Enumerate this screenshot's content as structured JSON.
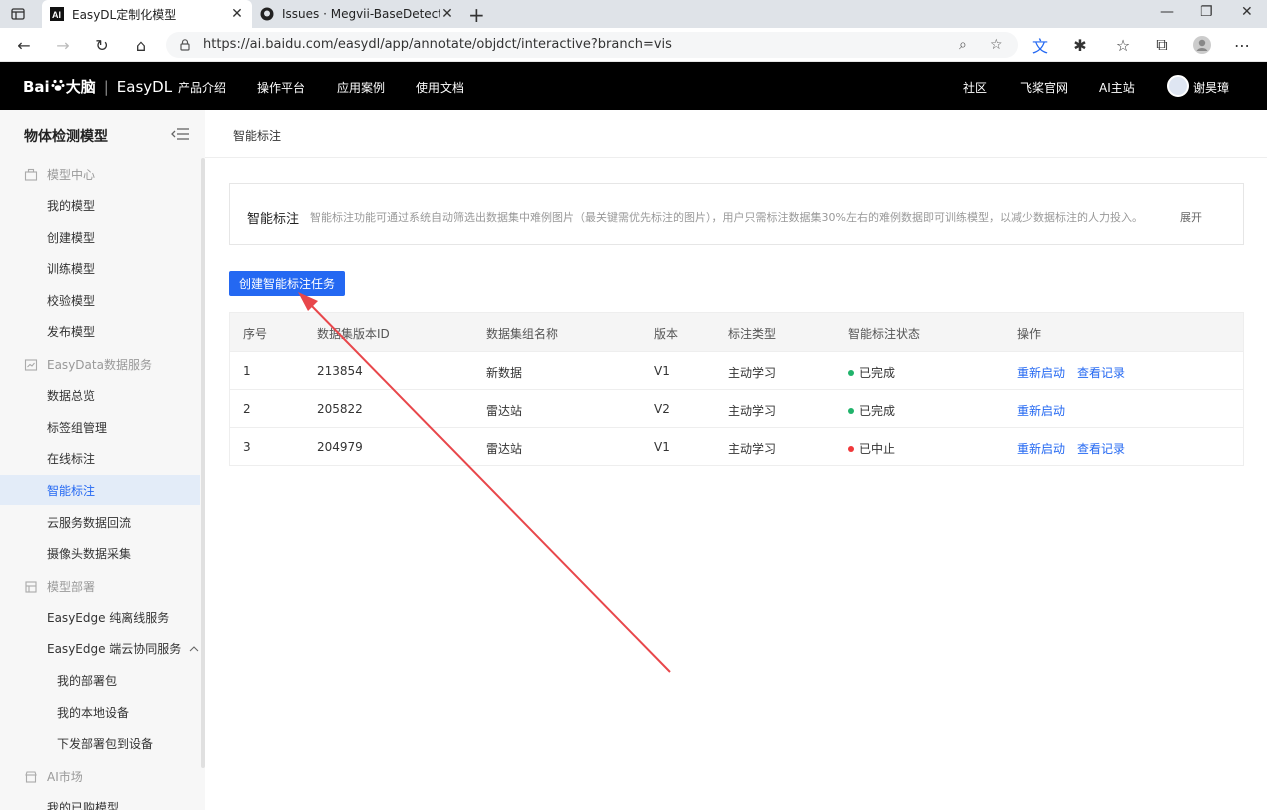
{
  "browser": {
    "tabs": [
      {
        "title": "EasyDL定制化模型",
        "active": true
      },
      {
        "title": "Issues · Megvii-BaseDetection/Y(",
        "active": false
      }
    ],
    "url": "https://ai.baidu.com/easydl/app/annotate/objdct/interactive?branch=vis"
  },
  "header": {
    "brand": "Bai",
    "brand_suffix": "大脑",
    "product": "EasyDL",
    "nav": [
      "产品介绍",
      "操作平台",
      "应用案例",
      "使用文档"
    ],
    "right_nav": [
      "社区",
      "飞桨官网",
      "AI主站"
    ],
    "user_name": "谢昊璋"
  },
  "sidebar": {
    "title": "物体检测模型",
    "groups": [
      {
        "label": "模型中心",
        "items": [
          "我的模型",
          "创建模型",
          "训练模型",
          "校验模型",
          "发布模型"
        ]
      },
      {
        "label": "EasyData数据服务",
        "items": [
          "数据总览",
          "标签组管理",
          "在线标注",
          "智能标注",
          "云服务数据回流",
          "摄像头数据采集"
        ]
      },
      {
        "label": "模型部署",
        "items": [
          "EasyEdge 纯离线服务",
          "EasyEdge 端云协同服务"
        ],
        "sub_items": [
          "我的部署包",
          "我的本地设备",
          "下发部署包到设备"
        ]
      },
      {
        "label": "AI市场",
        "items": [
          "我的已购模型"
        ]
      }
    ],
    "active_item": "智能标注"
  },
  "main": {
    "breadcrumb": "智能标注",
    "info": {
      "title": "智能标注",
      "description": "智能标注功能可通过系统自动筛选出数据集中难例图片（最关键需优先标注的图片），用户只需标注数据集30%左右的难例数据即可训练模型，以减少数据标注的人力投入。",
      "expand": "展开"
    },
    "create_button": "创建智能标注任务",
    "table": {
      "headers": [
        "序号",
        "数据集版本ID",
        "数据集组名称",
        "版本",
        "标注类型",
        "智能标注状态",
        "操作"
      ],
      "rows": [
        {
          "index": "1",
          "id": "213854",
          "name": "新数据",
          "version": "V1",
          "type": "主动学习",
          "status": "已完成",
          "status_color": "#20b36b",
          "actions": [
            "重新启动",
            "查看记录"
          ]
        },
        {
          "index": "2",
          "id": "205822",
          "name": "雷达站",
          "version": "V2",
          "type": "主动学习",
          "status": "已完成",
          "status_color": "#20b36b",
          "actions": [
            "重新启动"
          ]
        },
        {
          "index": "3",
          "id": "204979",
          "name": "雷达站",
          "version": "V1",
          "type": "主动学习",
          "status": "已中止",
          "status_color": "#f0383a",
          "actions": [
            "重新启动",
            "查看记录"
          ]
        }
      ]
    }
  },
  "colors": {
    "accent": "#2468f2",
    "annotation_arrow": "#e8474b"
  }
}
